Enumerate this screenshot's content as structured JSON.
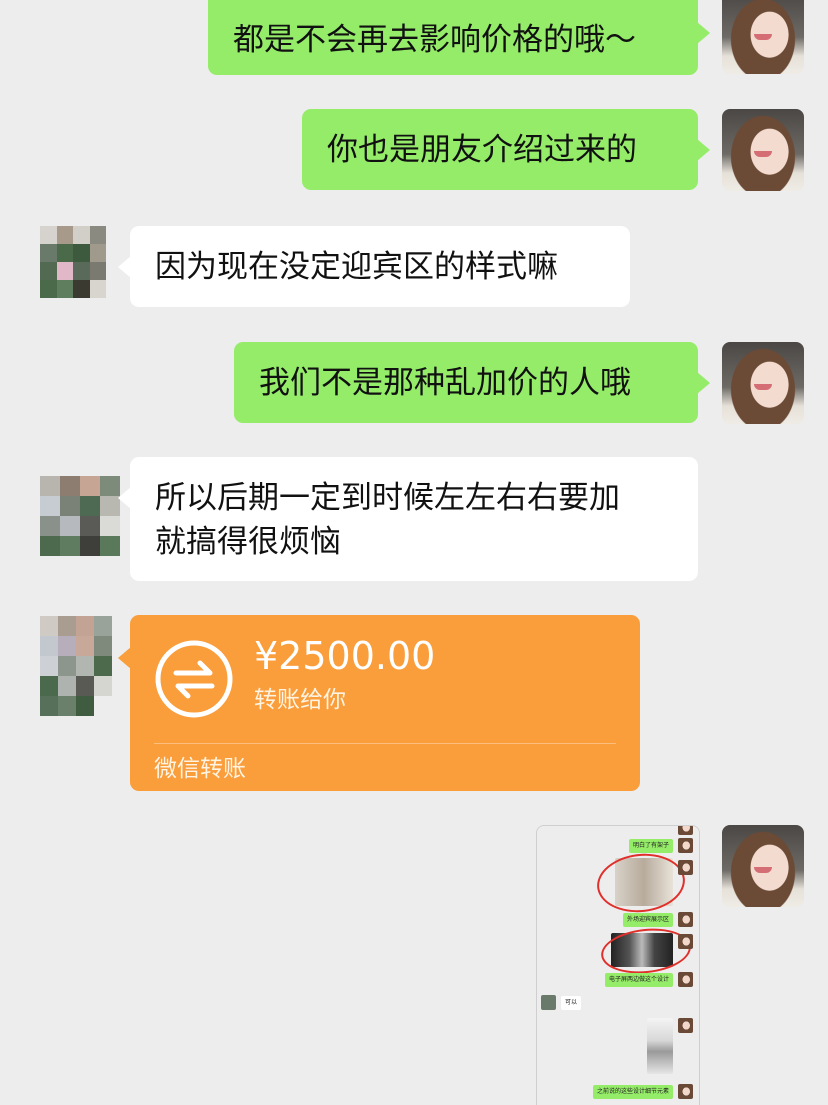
{
  "messages": [
    {
      "text": "都是不会再去影响价格的哦～",
      "from": "me"
    },
    {
      "text": "你也是朋友介绍过来的",
      "from": "me"
    },
    {
      "text": "因为现在没定迎宾区的样式嘛",
      "from": "other"
    },
    {
      "text": "我们不是那种乱加价的人哦",
      "from": "me"
    },
    {
      "line1": "所以后期一定到时候左左右右要加",
      "line2": "就搞得很烦恼",
      "from": "other"
    }
  ],
  "transfer": {
    "amount": "¥2500.00",
    "description": "转账给你",
    "footer": "微信转账",
    "icon": "transfer-arrows-icon",
    "color": "#fa9d3b"
  },
  "screenshot": {
    "m1": "明白了有架子",
    "m2": "外场迎宾展示区",
    "m3": "电子屏两边做这个设计",
    "m4": "可以",
    "m5": "之前说的这些设计细节元素"
  },
  "colors": {
    "background": "#ededed",
    "sent_bubble": "#95ec69",
    "received_bubble": "#ffffff"
  }
}
